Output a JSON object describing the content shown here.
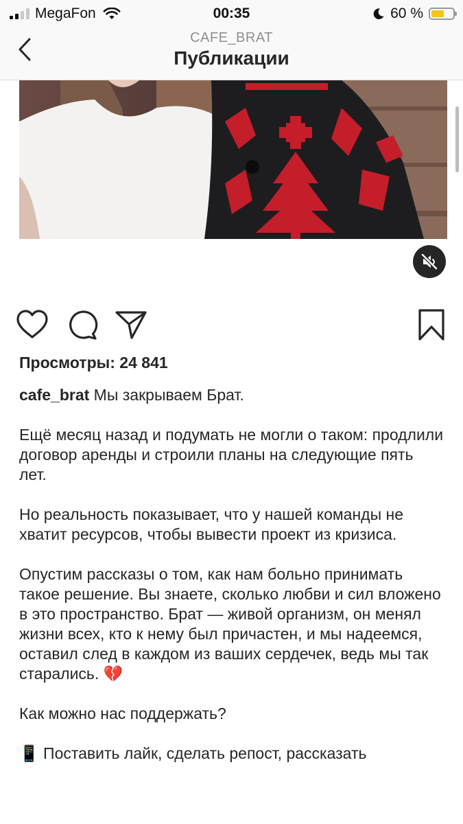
{
  "status_bar": {
    "carrier": "MegaFon",
    "time": "00:35",
    "battery_text": "60 %",
    "battery_level": 0.6,
    "battery_color": "#f5c518",
    "icons": [
      "signal-icon",
      "wifi-icon",
      "moon-icon",
      "battery-icon"
    ]
  },
  "header": {
    "account": "CAFE_BRAT",
    "title": "Публикации"
  },
  "post": {
    "views": "Просмотры: 24 841",
    "author": "cafe_brat",
    "first_line": "Мы закрываем Брат.",
    "paragraphs": [
      "Ещё месяц назад и подумать не могли о таком: продлили договор аренды и строили планы на следующие пять лет.",
      "Но реальность показывает, что у нашей команды не хватит ресурсов, чтобы вывести проект из кризиса.",
      "Опустим рассказы о том, как нам больно принимать такое решение. Вы знаете, сколько любви и сил вложено в это пространство. Брат — живой организм, он менял жизни всех, кто к нему был причастен, и мы надеемся, оставил след в каждом из ваших сердечек, ведь мы так старались.",
      "Как можно нас поддержать?",
      "Поставить лайк, сделать репост, рассказать"
    ],
    "broken_heart_emoji": "💔",
    "phone_emoji": "📱"
  }
}
